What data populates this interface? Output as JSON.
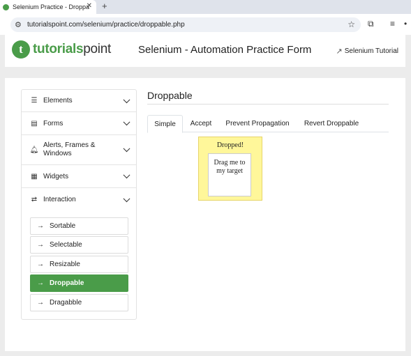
{
  "browser": {
    "tab_title": "Selenium Practice - Droppable",
    "tab_close": "✕",
    "new_tab": "+",
    "url": "tutorialspoint.com/selenium/practice/droppable.php"
  },
  "header": {
    "logo_mark": "t",
    "logo_text_bold": "tutorials",
    "logo_text_light": "point",
    "title": "Selenium - Automation Practice Form",
    "external_link": "Selenium Tutorial"
  },
  "sidebar": {
    "items": [
      {
        "label": "Elements",
        "icon": "hamburger-icon"
      },
      {
        "label": "Forms",
        "icon": "form-icon"
      },
      {
        "label": "Alerts, Frames & Windows",
        "icon": "bell-icon"
      },
      {
        "label": "Widgets",
        "icon": "widgets-icon"
      },
      {
        "label": "Interaction",
        "icon": "swap-icon"
      }
    ],
    "sub_items": [
      {
        "label": "Sortable",
        "active": false
      },
      {
        "label": "Selectable",
        "active": false
      },
      {
        "label": "Resizable",
        "active": false
      },
      {
        "label": "Droppable",
        "active": true
      },
      {
        "label": "Dragabble",
        "active": false
      }
    ]
  },
  "main": {
    "title": "Droppable",
    "tabs": [
      {
        "label": "Simple",
        "active": true
      },
      {
        "label": "Accept",
        "active": false
      },
      {
        "label": "Prevent Propagation",
        "active": false
      },
      {
        "label": "Revert Droppable",
        "active": false
      }
    ],
    "drop_label": "Dropped!",
    "drag_label": "Drag me to my target"
  },
  "colors": {
    "brand_green": "#4a9c49",
    "drop_yellow": "#fff79a"
  }
}
